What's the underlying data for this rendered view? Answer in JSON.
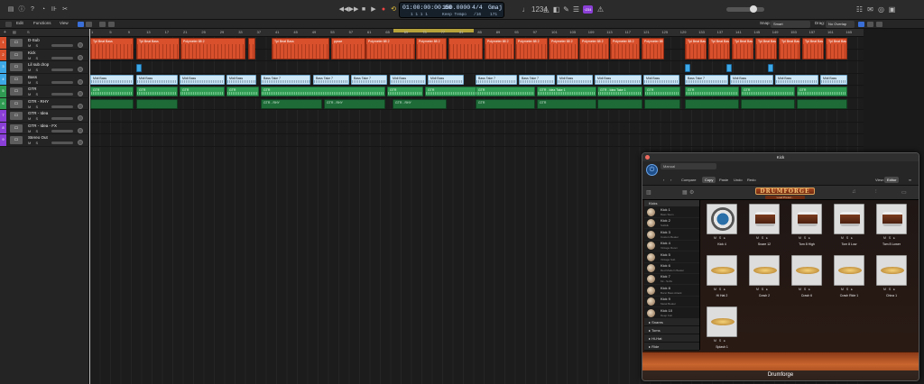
{
  "colors": {
    "accent": "#3a6fd8",
    "region_red": "#d8502c",
    "region_blue": "#3da8e6",
    "region_green": "#2f9b52",
    "cycle": "#b6a23a"
  },
  "controlbar": {
    "lcd_time": "01:00:00:00.00",
    "lcd_tempo": "150.0000",
    "lcd_sig": "4/4",
    "lcd_key": "Gmaj",
    "lcd_bars": "1  1  1     1",
    "lcd_tempo_mode": "Keep Tempo",
    "lcd_div": "/16",
    "lcd_extra": "171",
    "badge": "‹234"
  },
  "editbar": {
    "edit": "Edit",
    "functions": "Functions",
    "view": "View",
    "snap_label": "Snap:",
    "snap_value": "Smart",
    "drag_label": "Drag:",
    "drag_value": "No Overlap"
  },
  "tracks": [
    {
      "num": "1",
      "name": "D-Sub",
      "color": "#d8502c"
    },
    {
      "num": "2",
      "name": "Kick",
      "color": "#d8502c"
    },
    {
      "num": "3",
      "name": "Lil sub drop",
      "color": "#3da8e6"
    },
    {
      "num": "4",
      "name": "Bass",
      "color": "#3da8e6"
    },
    {
      "num": "5",
      "name": "GTR",
      "color": "#2f9b52"
    },
    {
      "num": "6",
      "name": "GTR - RHY",
      "color": "#2f9b52"
    },
    {
      "num": "7",
      "name": "GTR - Idea",
      "color": "#8a3fd6"
    },
    {
      "num": "8",
      "name": "GTR - Idea - FX",
      "color": "#8a3fd6"
    },
    {
      "num": "9",
      "name": "Stereo Out",
      "color": "#8a3fd6"
    }
  ],
  "ruler": [
    "1",
    "5",
    "9",
    "13",
    "17",
    "21",
    "25",
    "29",
    "33",
    "37",
    "41",
    "45",
    "49",
    "53",
    "57",
    "61",
    "65",
    "69",
    "73",
    "77",
    "81",
    "85",
    "89",
    "93",
    "97",
    "101",
    "105",
    "109",
    "113",
    "117",
    "121",
    "125",
    "129",
    "133",
    "137",
    "141",
    "145",
    "149",
    "153",
    "157",
    "161",
    "165",
    "169"
  ],
  "regions": {
    "drums1": "Tpl Beat Bass",
    "drums2": "Polymeter 88 2",
    "drums3": "ppsse",
    "drums4": "Polymeter 88 2",
    "bass": "Midi Bass",
    "bass2": "Bass Take 7",
    "gtr": "GTR",
    "gtr2": "GTR - Idea Take 1",
    "gtr3": "GTR - RHY"
  },
  "plugin": {
    "window_title": "Kick",
    "preset_menu": "Manual",
    "compare": "Compare",
    "copy": "Copy",
    "paste": "Paste",
    "undo": "Undo",
    "redo": "Redo",
    "view_label": "View:",
    "view_value": "Editor",
    "logo": "DRUMFORGE",
    "load_preset": "Load Preset...",
    "sidebar_header": "Kicks",
    "kicks": [
      {
        "name": "Kick 1",
        "sub": "Bass Stem"
      },
      {
        "name": "Kick 2",
        "sub": "Subkik"
      },
      {
        "name": "Kick 3",
        "sub": "Custom Beater"
      },
      {
        "name": "Kick 4",
        "sub": "Vintage Room"
      },
      {
        "name": "Kick 5",
        "sub": "Vintage Sub"
      },
      {
        "name": "Kick 6",
        "sub": "Red Modern Beater"
      },
      {
        "name": "Kick 7",
        "sub": "Kk - Softs"
      },
      {
        "name": "Kick 8",
        "sub": "Burst Bass Attack"
      },
      {
        "name": "Kick 9",
        "sub": "Metal Beater"
      },
      {
        "name": "Kick 10",
        "sub": "Deep Felt"
      }
    ],
    "categories": [
      "Snares",
      "Toms",
      "Hi-Hat",
      "Ride"
    ],
    "pads": [
      {
        "label": "Kick 4",
        "kind": "kick"
      },
      {
        "label": "Snare 12",
        "kind": "drum"
      },
      {
        "label": "Tom 8 High",
        "kind": "drum"
      },
      {
        "label": "Tom 8 Low",
        "kind": "drum"
      },
      {
        "label": "Tom 8 Lower",
        "kind": "drum"
      },
      {
        "label": "Hi Hat 2",
        "kind": "cym"
      },
      {
        "label": "Crash 2",
        "kind": "cym"
      },
      {
        "label": "Crash 6",
        "kind": "cym"
      },
      {
        "label": "Crash Ride 1",
        "kind": "cym"
      },
      {
        "label": "China 1",
        "kind": "cym"
      },
      {
        "label": "Splash 1",
        "kind": "cym"
      }
    ],
    "footer": "Drumforge"
  }
}
